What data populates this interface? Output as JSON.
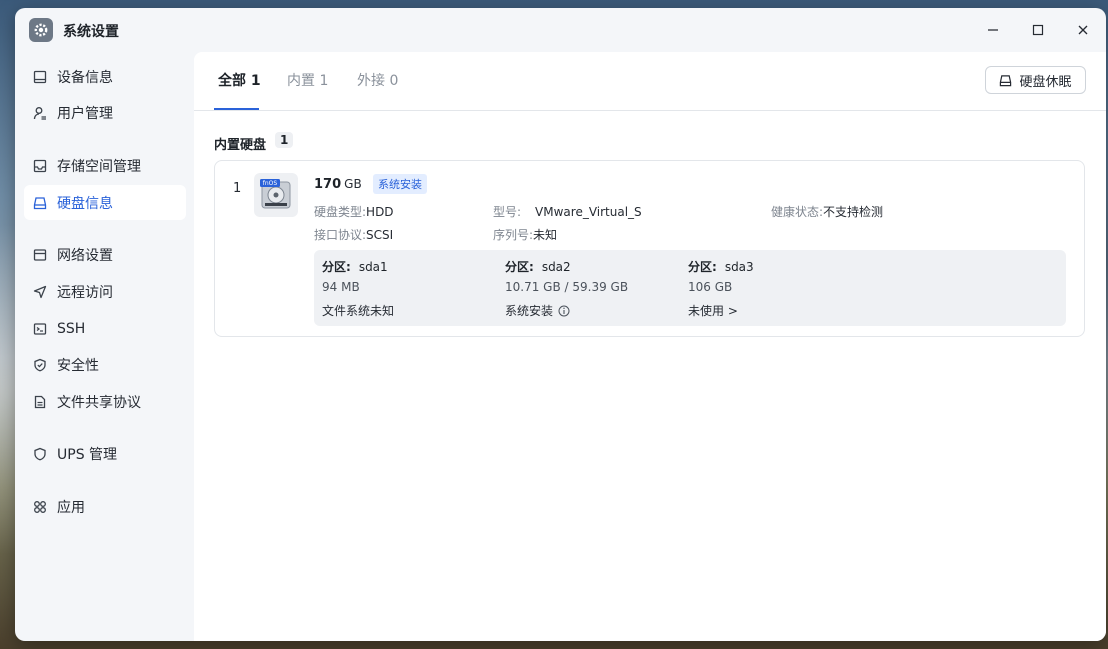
{
  "window": {
    "title": "系统设置"
  },
  "sidebar": {
    "items": [
      {
        "label": "设备信息",
        "icon": "device-icon"
      },
      {
        "label": "用户管理",
        "icon": "user-icon"
      },
      {
        "label": "存储空间管理",
        "icon": "storage-icon"
      },
      {
        "label": "硬盘信息",
        "icon": "disk-icon",
        "active": true
      },
      {
        "label": "网络设置",
        "icon": "network-icon"
      },
      {
        "label": "远程访问",
        "icon": "remote-icon"
      },
      {
        "label": "SSH",
        "icon": "terminal-icon"
      },
      {
        "label": "安全性",
        "icon": "shield-icon"
      },
      {
        "label": "文件共享协议",
        "icon": "file-icon"
      },
      {
        "label": "UPS 管理",
        "icon": "ups-icon"
      },
      {
        "label": "应用",
        "icon": "apps-icon"
      }
    ]
  },
  "tabs": [
    {
      "label": "全部 1",
      "active": true
    },
    {
      "label": "内置 1"
    },
    {
      "label": "外接 0"
    }
  ],
  "toolbar": {
    "sleep_label": "硬盘休眠"
  },
  "section": {
    "title": "内置硬盘",
    "count": "1"
  },
  "disk": {
    "index": "1",
    "size_num": "170",
    "size_unit": "GB",
    "badge": "系统安装",
    "type_key": "硬盘类型:",
    "type_val": "HDD",
    "model_key": "型号:",
    "model_val": "VMware_Virtual_S",
    "health_key": "健康状态:",
    "health_val": "不支持检测",
    "iface_key": "接口协议:",
    "iface_val": "SCSI",
    "serial_key": "序列号:",
    "serial_val": "未知",
    "logo_text": "fnOS"
  },
  "partitions": [
    {
      "key": "分区:",
      "name": "sda1",
      "size": "94 MB",
      "state": "文件系统未知"
    },
    {
      "key": "分区:",
      "name": "sda2",
      "size": "10.71 GB / 59.39 GB",
      "state": "系统安装"
    },
    {
      "key": "分区:",
      "name": "sda3",
      "size": "106 GB",
      "state": "未使用 >"
    }
  ],
  "colors": {
    "accent": "#2a62d9",
    "sidebar_bg": "#f4f6f9"
  }
}
